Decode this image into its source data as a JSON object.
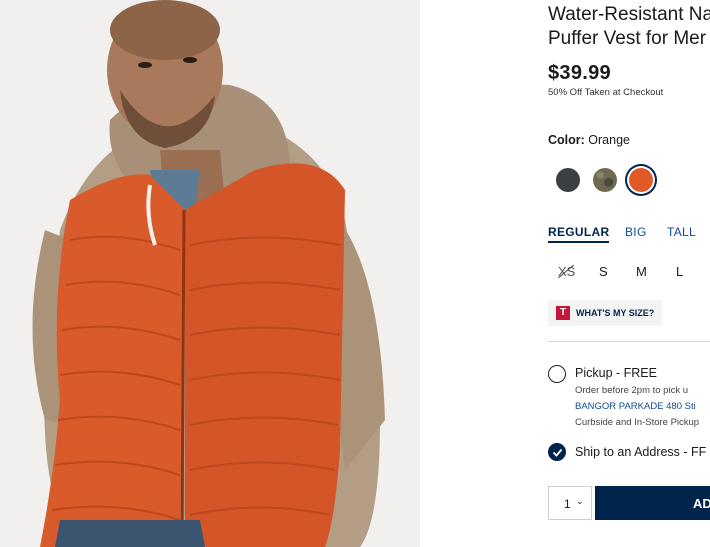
{
  "product": {
    "title_line1": "Water-Resistant Na",
    "title_line2": "Puffer Vest for Mer",
    "price": "$39.99",
    "promo": "50% Off Taken at Checkout"
  },
  "color": {
    "label": "Color:",
    "selected": "Orange",
    "swatches": [
      {
        "name": "charcoal",
        "hex": "#3b3f45"
      },
      {
        "name": "camo",
        "hex": "#6e6a52"
      },
      {
        "name": "orange",
        "hex": "#e05a28",
        "selected": true
      }
    ]
  },
  "fits": [
    "REGULAR",
    "BIG",
    "TALL"
  ],
  "selected_fit": "REGULAR",
  "sizes": [
    {
      "label": "XS",
      "available": false
    },
    {
      "label": "S",
      "available": true
    },
    {
      "label": "M",
      "available": true
    },
    {
      "label": "L",
      "available": true
    }
  ],
  "fit_guide": {
    "badge": "T",
    "label": "WHAT'S MY SIZE?"
  },
  "fulfillment": {
    "pickup": {
      "title": "Pickup - FREE",
      "line1": "Order before 2pm to pick u",
      "store": "BANGOR PARKADE 480 Sti",
      "line2": "Curbside and In-Store Pickup"
    },
    "ship": {
      "title": "Ship to an Address - FF"
    }
  },
  "quantity": "1",
  "add_button": "AD",
  "colors": {
    "navy": "#00254d",
    "link": "#0f4c92",
    "vest": "#d95a2b"
  }
}
